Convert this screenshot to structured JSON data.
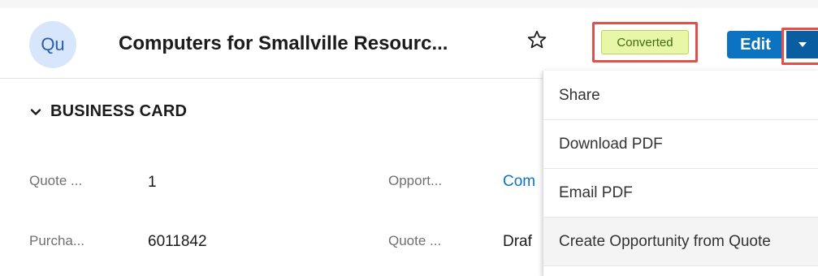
{
  "header": {
    "avatar_text": "Qu",
    "record_title": "Computers for Smallville Resourc...",
    "status_badge": "Converted",
    "edit_label": "Edit"
  },
  "section": {
    "title": "BUSINESS CARD"
  },
  "fields": [
    {
      "label": "Quote ...",
      "value": "1"
    },
    {
      "label": "Opport...",
      "value": "Com"
    },
    {
      "label": "Purcha...",
      "value": "6011842"
    },
    {
      "label": "Quote ...",
      "value": "Draf"
    }
  ],
  "actions_menu": {
    "items": [
      {
        "label": "Share"
      },
      {
        "label": "Download PDF"
      },
      {
        "label": "Email PDF"
      },
      {
        "label": "Create Opportunity from Quote"
      }
    ]
  },
  "colors": {
    "primary": "#0b73c2",
    "highlight": "#e0514b",
    "badge_bg": "#e7f7a7"
  }
}
